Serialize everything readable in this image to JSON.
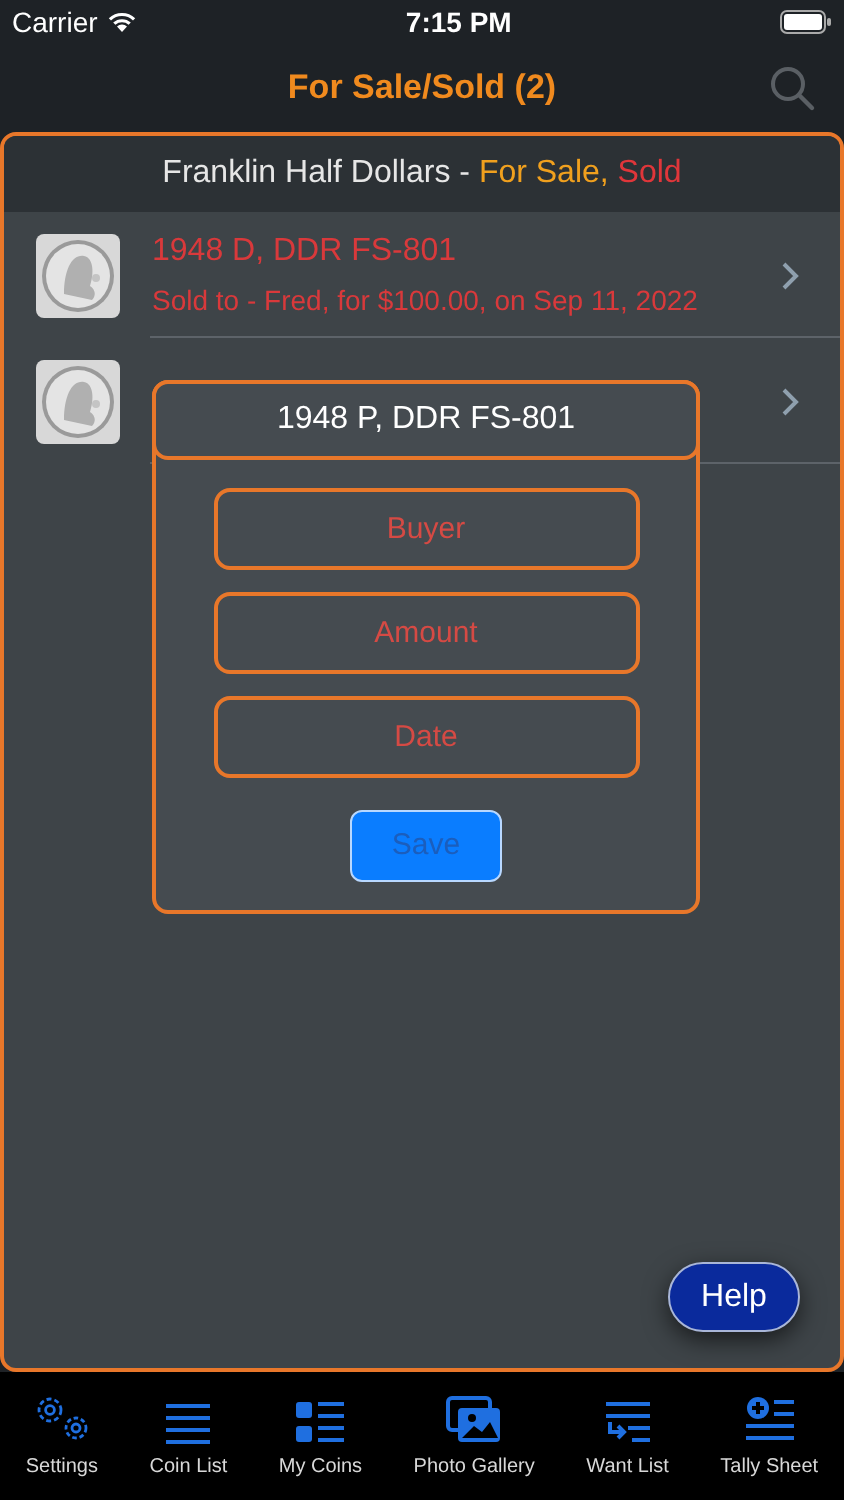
{
  "status_bar": {
    "carrier": "Carrier",
    "time": "7:15 PM"
  },
  "nav": {
    "title": "For Sale/Sold (2)"
  },
  "list": {
    "header": [
      {
        "kind": "title",
        "text": "Franklin Half Dollars - "
      },
      {
        "kind": "for_sale",
        "text": "For Sale, "
      },
      {
        "kind": "sold",
        "text": "Sold"
      }
    ],
    "rows": [
      {
        "color": "#d9393b",
        "title": "1948 D, DDR FS-801",
        "subtitle": "Sold to - Fred, for $100.00, on Sep 11, 2022"
      },
      {}
    ]
  },
  "dialog": {
    "title": "1948 P, DDR FS-801",
    "fields": [
      {
        "placeholder": "Buyer"
      },
      {
        "placeholder": "Amount"
      },
      {
        "placeholder": "Date"
      }
    ],
    "save_button": {
      "label": "Save",
      "disabled": true
    }
  },
  "help_button": {
    "label": "Help"
  },
  "tabs": [
    {
      "label": "Settings",
      "selected": false
    },
    {
      "label": "Coin List",
      "selected": false
    },
    {
      "label": "My Coins",
      "selected": false
    },
    {
      "label": "Photo Gallery",
      "selected": false
    },
    {
      "label": "Want List",
      "selected": false
    },
    {
      "label": "Tally Sheet",
      "selected": false
    }
  ]
}
